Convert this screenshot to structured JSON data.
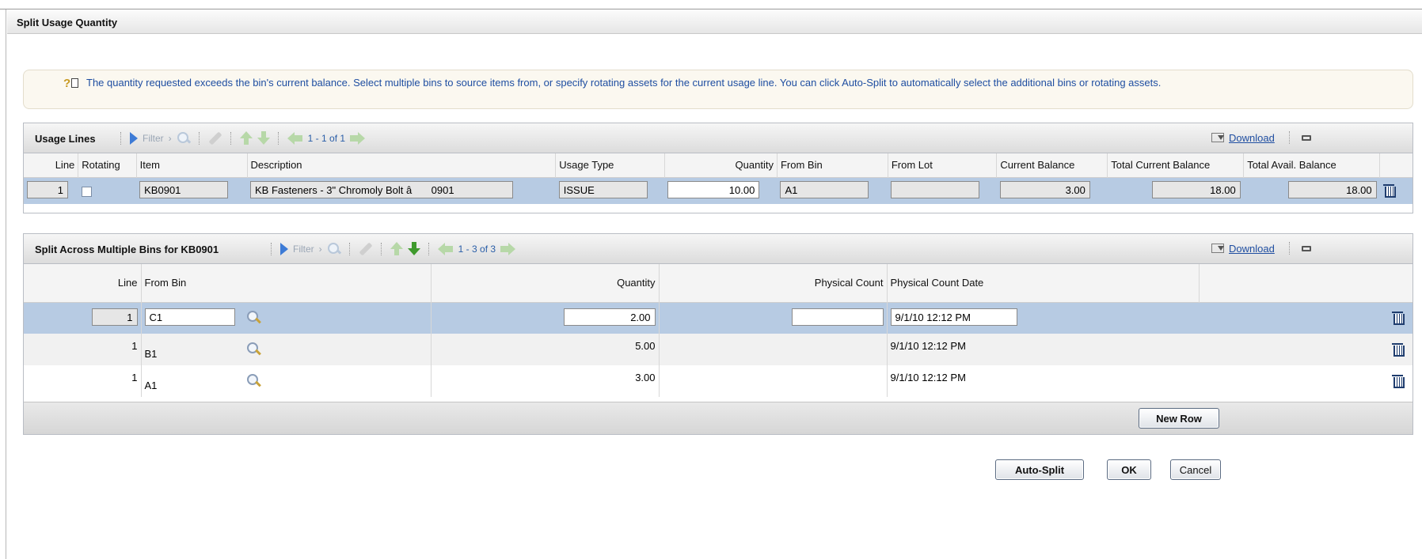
{
  "dialog": {
    "title": "Split Usage Quantity"
  },
  "message": "The quantity requested exceeds the bin's current balance. Select multiple bins to source items from, or specify rotating assets for the current usage line. You can click Auto-Split to automatically select the additional bins or rotating assets.",
  "usage_lines": {
    "title": "Usage Lines",
    "filter_label": "Filter",
    "pager": "1 - 1 of 1",
    "download_label": "Download",
    "columns": [
      "Line",
      "Rotating",
      "Item",
      "Description",
      "Usage Type",
      "Quantity",
      "From Bin",
      "From Lot",
      "Current Balance",
      "Total Current Balance",
      "Total Avail. Balance"
    ],
    "row": {
      "line": "1",
      "item": "KB0901",
      "description": "KB Fasteners - 3\" Chromoly Bolt â 0901",
      "usage_type": "ISSUE",
      "quantity": "10.00",
      "from_bin": "A1",
      "from_lot": "",
      "current_balance": "3.00",
      "total_current_balance": "18.00",
      "total_avail_balance": "18.00"
    }
  },
  "split": {
    "title": "Split Across Multiple Bins for KB0901",
    "filter_label": "Filter",
    "pager": "1 - 3 of 3",
    "download_label": "Download",
    "columns": [
      "Line",
      "From Bin",
      "Quantity",
      "Physical Count",
      "Physical Count Date"
    ],
    "rows": [
      {
        "line": "1",
        "from_bin": "C1",
        "quantity": "2.00",
        "physical_count": "",
        "date": "9/1/10 12:12 PM"
      },
      {
        "line": "1",
        "from_bin": "B1",
        "quantity": "5.00",
        "physical_count": "",
        "date": "9/1/10 12:12 PM"
      },
      {
        "line": "1",
        "from_bin": "A1",
        "quantity": "3.00",
        "physical_count": "",
        "date": "9/1/10 12:12 PM"
      }
    ],
    "new_row_label": "New Row"
  },
  "buttons": {
    "auto_split": "Auto-Split",
    "ok": "OK",
    "cancel": "Cancel"
  },
  "colors": {
    "selected_row": "#b7cbe3",
    "link": "#1f4ea1",
    "message_text": "#1f4ea1"
  }
}
